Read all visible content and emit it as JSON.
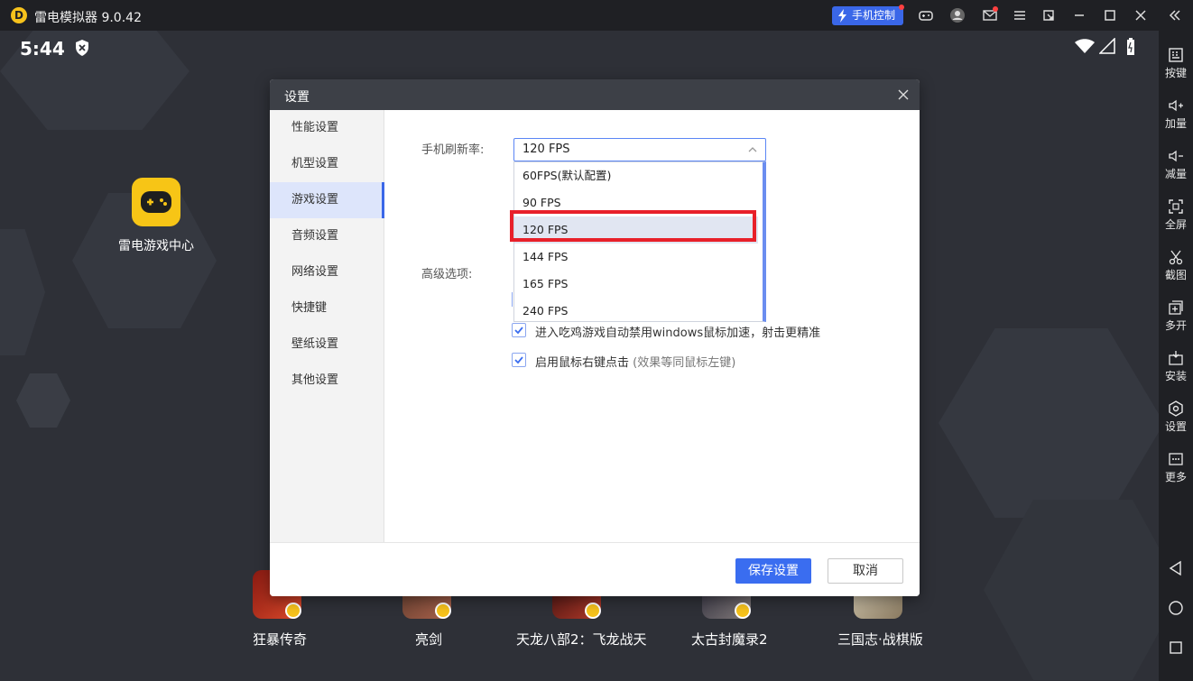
{
  "window": {
    "title": "雷电模拟器 9.0.42",
    "phone_control_label": "手机控制"
  },
  "statusbar": {
    "time": "5:44"
  },
  "desktop": {
    "app_label": "雷电游戏中心",
    "dock": [
      "狂暴传奇",
      "亮剑",
      "天龙八部2：飞龙战天",
      "太古封魔录2",
      "三国志·战棋版"
    ]
  },
  "sidebar": {
    "items": [
      "按键",
      "加量",
      "减量",
      "全屏",
      "截图",
      "多开",
      "安装",
      "设置",
      "更多"
    ]
  },
  "dialog": {
    "title": "设置",
    "nav": [
      "性能设置",
      "机型设置",
      "游戏设置",
      "音频设置",
      "网络设置",
      "快捷键",
      "壁纸设置",
      "其他设置"
    ],
    "active_nav": "游戏设置",
    "refresh_label": "手机刷新率:",
    "refresh_value": "120 FPS",
    "options": [
      "60FPS(默认配置)",
      "90 FPS",
      "120 FPS",
      "144 FPS",
      "165 FPS",
      "240 FPS"
    ],
    "advanced_label": "高级选项:",
    "check1": "进入吃鸡游戏自动禁用windows鼠标加速，射击更精准",
    "check2_main": "启用鼠标右键点击",
    "check2_note": "(效果等同鼠标左键)",
    "save": "保存设置",
    "cancel": "取消"
  },
  "colors": {
    "accent": "#3a6df0",
    "highlight": "#e8202a",
    "brand": "#f6c21c"
  }
}
